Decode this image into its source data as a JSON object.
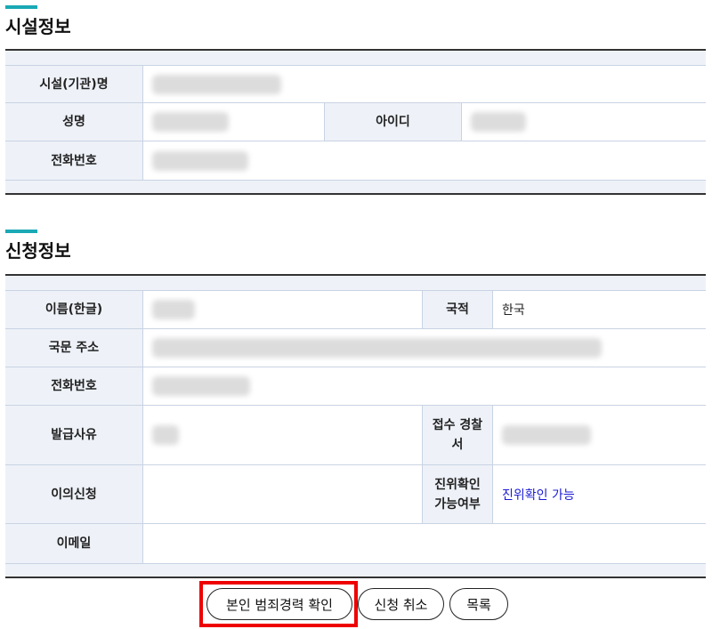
{
  "facility": {
    "title": "시설정보",
    "labels": {
      "name": "시설(기관)명",
      "person": "성명",
      "id": "아이디",
      "phone": "전화번호"
    }
  },
  "application": {
    "title": "신청정보",
    "labels": {
      "name_kr": "이름(한글)",
      "nationality": "국적",
      "address": "국문 주소",
      "phone": "전화번호",
      "reason": "발급사유",
      "police_station": "접수 경찰서",
      "objection": "이의신청",
      "verify": "진위확인 가능여부",
      "email": "이메일"
    },
    "values": {
      "nationality": "한국",
      "verify": "진위확인 가능",
      "objection": "",
      "email": ""
    }
  },
  "buttons": {
    "check_record": "본인 범죄경력 확인",
    "cancel": "신청 취소",
    "list": "목록"
  },
  "colors": {
    "accent": "#1aa9b5",
    "highlight": "#ee0000",
    "link": "#1a1ad6",
    "header_bg": "#eef2f8"
  }
}
